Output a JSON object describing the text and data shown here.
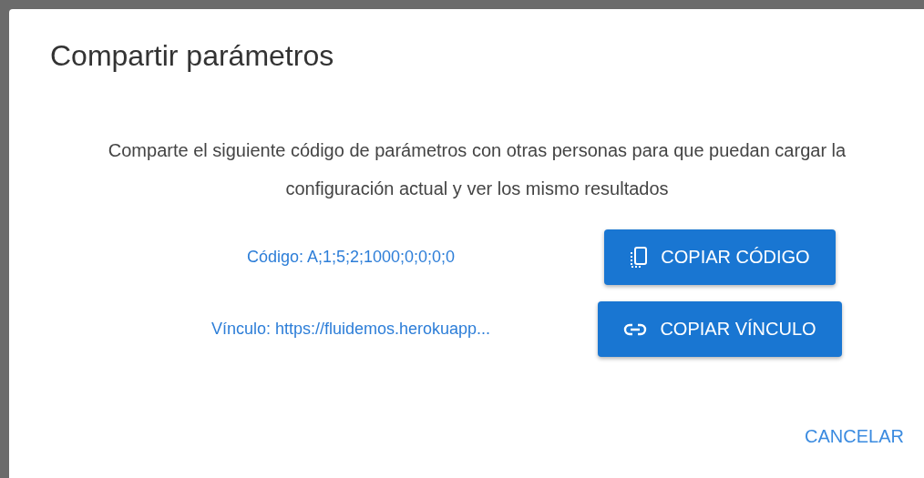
{
  "dialog": {
    "title": "Compartir parámetros",
    "message": "Comparte el siguiente código de parámetros con otras personas para que puedan cargar la configuración actual y ver los mismo resultados",
    "rows": [
      {
        "kind": "code",
        "text": "Código: A;1;5;2;1000;0;0;0;0",
        "button": "COPIAR CÓDIGO"
      },
      {
        "kind": "link",
        "text": "Vínculo: https://fluidemos.herokuapp...",
        "button": "COPIAR VÍNCULO"
      }
    ],
    "actions": [
      "CANCELAR"
    ]
  }
}
